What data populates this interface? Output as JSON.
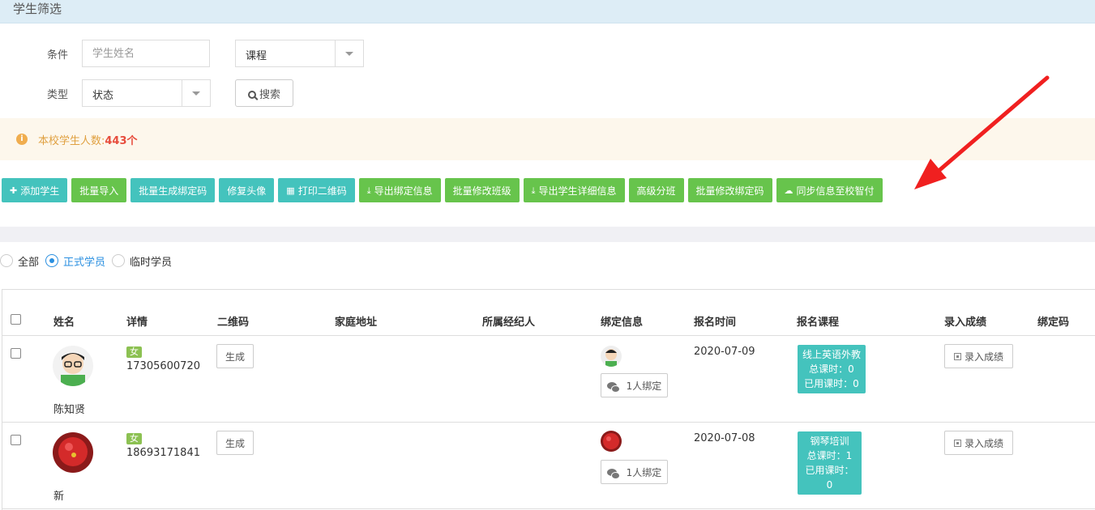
{
  "panel": {
    "title": "学生筛选"
  },
  "filters": {
    "condition_label": "条件",
    "name_placeholder": "学生姓名",
    "course_select": "课程",
    "type_label": "类型",
    "status_select": "状态",
    "search_label": "搜索"
  },
  "alert": {
    "text": "本校学生人数:",
    "count": "443个"
  },
  "toolbar": [
    {
      "label": "添加学生",
      "icon": "plus-icon"
    },
    {
      "label": "批量导入"
    },
    {
      "label": "批量生成绑定码"
    },
    {
      "label": "修复头像"
    },
    {
      "label": "打印二维码",
      "icon": "qrcode-icon"
    },
    {
      "label": "导出绑定信息",
      "icon": "download-icon"
    },
    {
      "label": "批量修改班级"
    },
    {
      "label": "导出学生详细信息",
      "icon": "download-icon"
    },
    {
      "label": "高级分班"
    },
    {
      "label": "批量修改绑定码"
    },
    {
      "label": "同步信息至校智付",
      "icon": "cloud-upload-icon"
    }
  ],
  "radios": [
    {
      "label": "全部",
      "checked": false
    },
    {
      "label": "正式学员",
      "checked": true
    },
    {
      "label": "临时学员",
      "checked": false
    }
  ],
  "table": {
    "headers": [
      "姓名",
      "详情",
      "二维码",
      "家庭地址",
      "所属经纪人",
      "绑定信息",
      "报名时间",
      "报名课程",
      "录入成绩",
      "绑定码"
    ],
    "rows": [
      {
        "name": "陈知贤",
        "gender": "女",
        "phone": "17305600720",
        "qr_button": "生成",
        "bind_button": "1人绑定",
        "date": "2020-07-09",
        "course": {
          "name": "线上英语外教",
          "total": "总课时：0",
          "used": "已用课时：0"
        },
        "score_button": "录入成绩"
      },
      {
        "name": "新",
        "gender": "女",
        "phone": "18693171841",
        "qr_button": "生成",
        "bind_button": "1人绑定",
        "date": "2020-07-08",
        "course": {
          "name": "钢琴培训",
          "total": "总课时：1",
          "used": "已用课时：0"
        },
        "score_button": "录入成绩"
      }
    ]
  },
  "colors": {
    "teal": "#44c3bd",
    "green": "#67c44c",
    "arrow": "#f02020",
    "link_blue": "#2a8fe0"
  }
}
